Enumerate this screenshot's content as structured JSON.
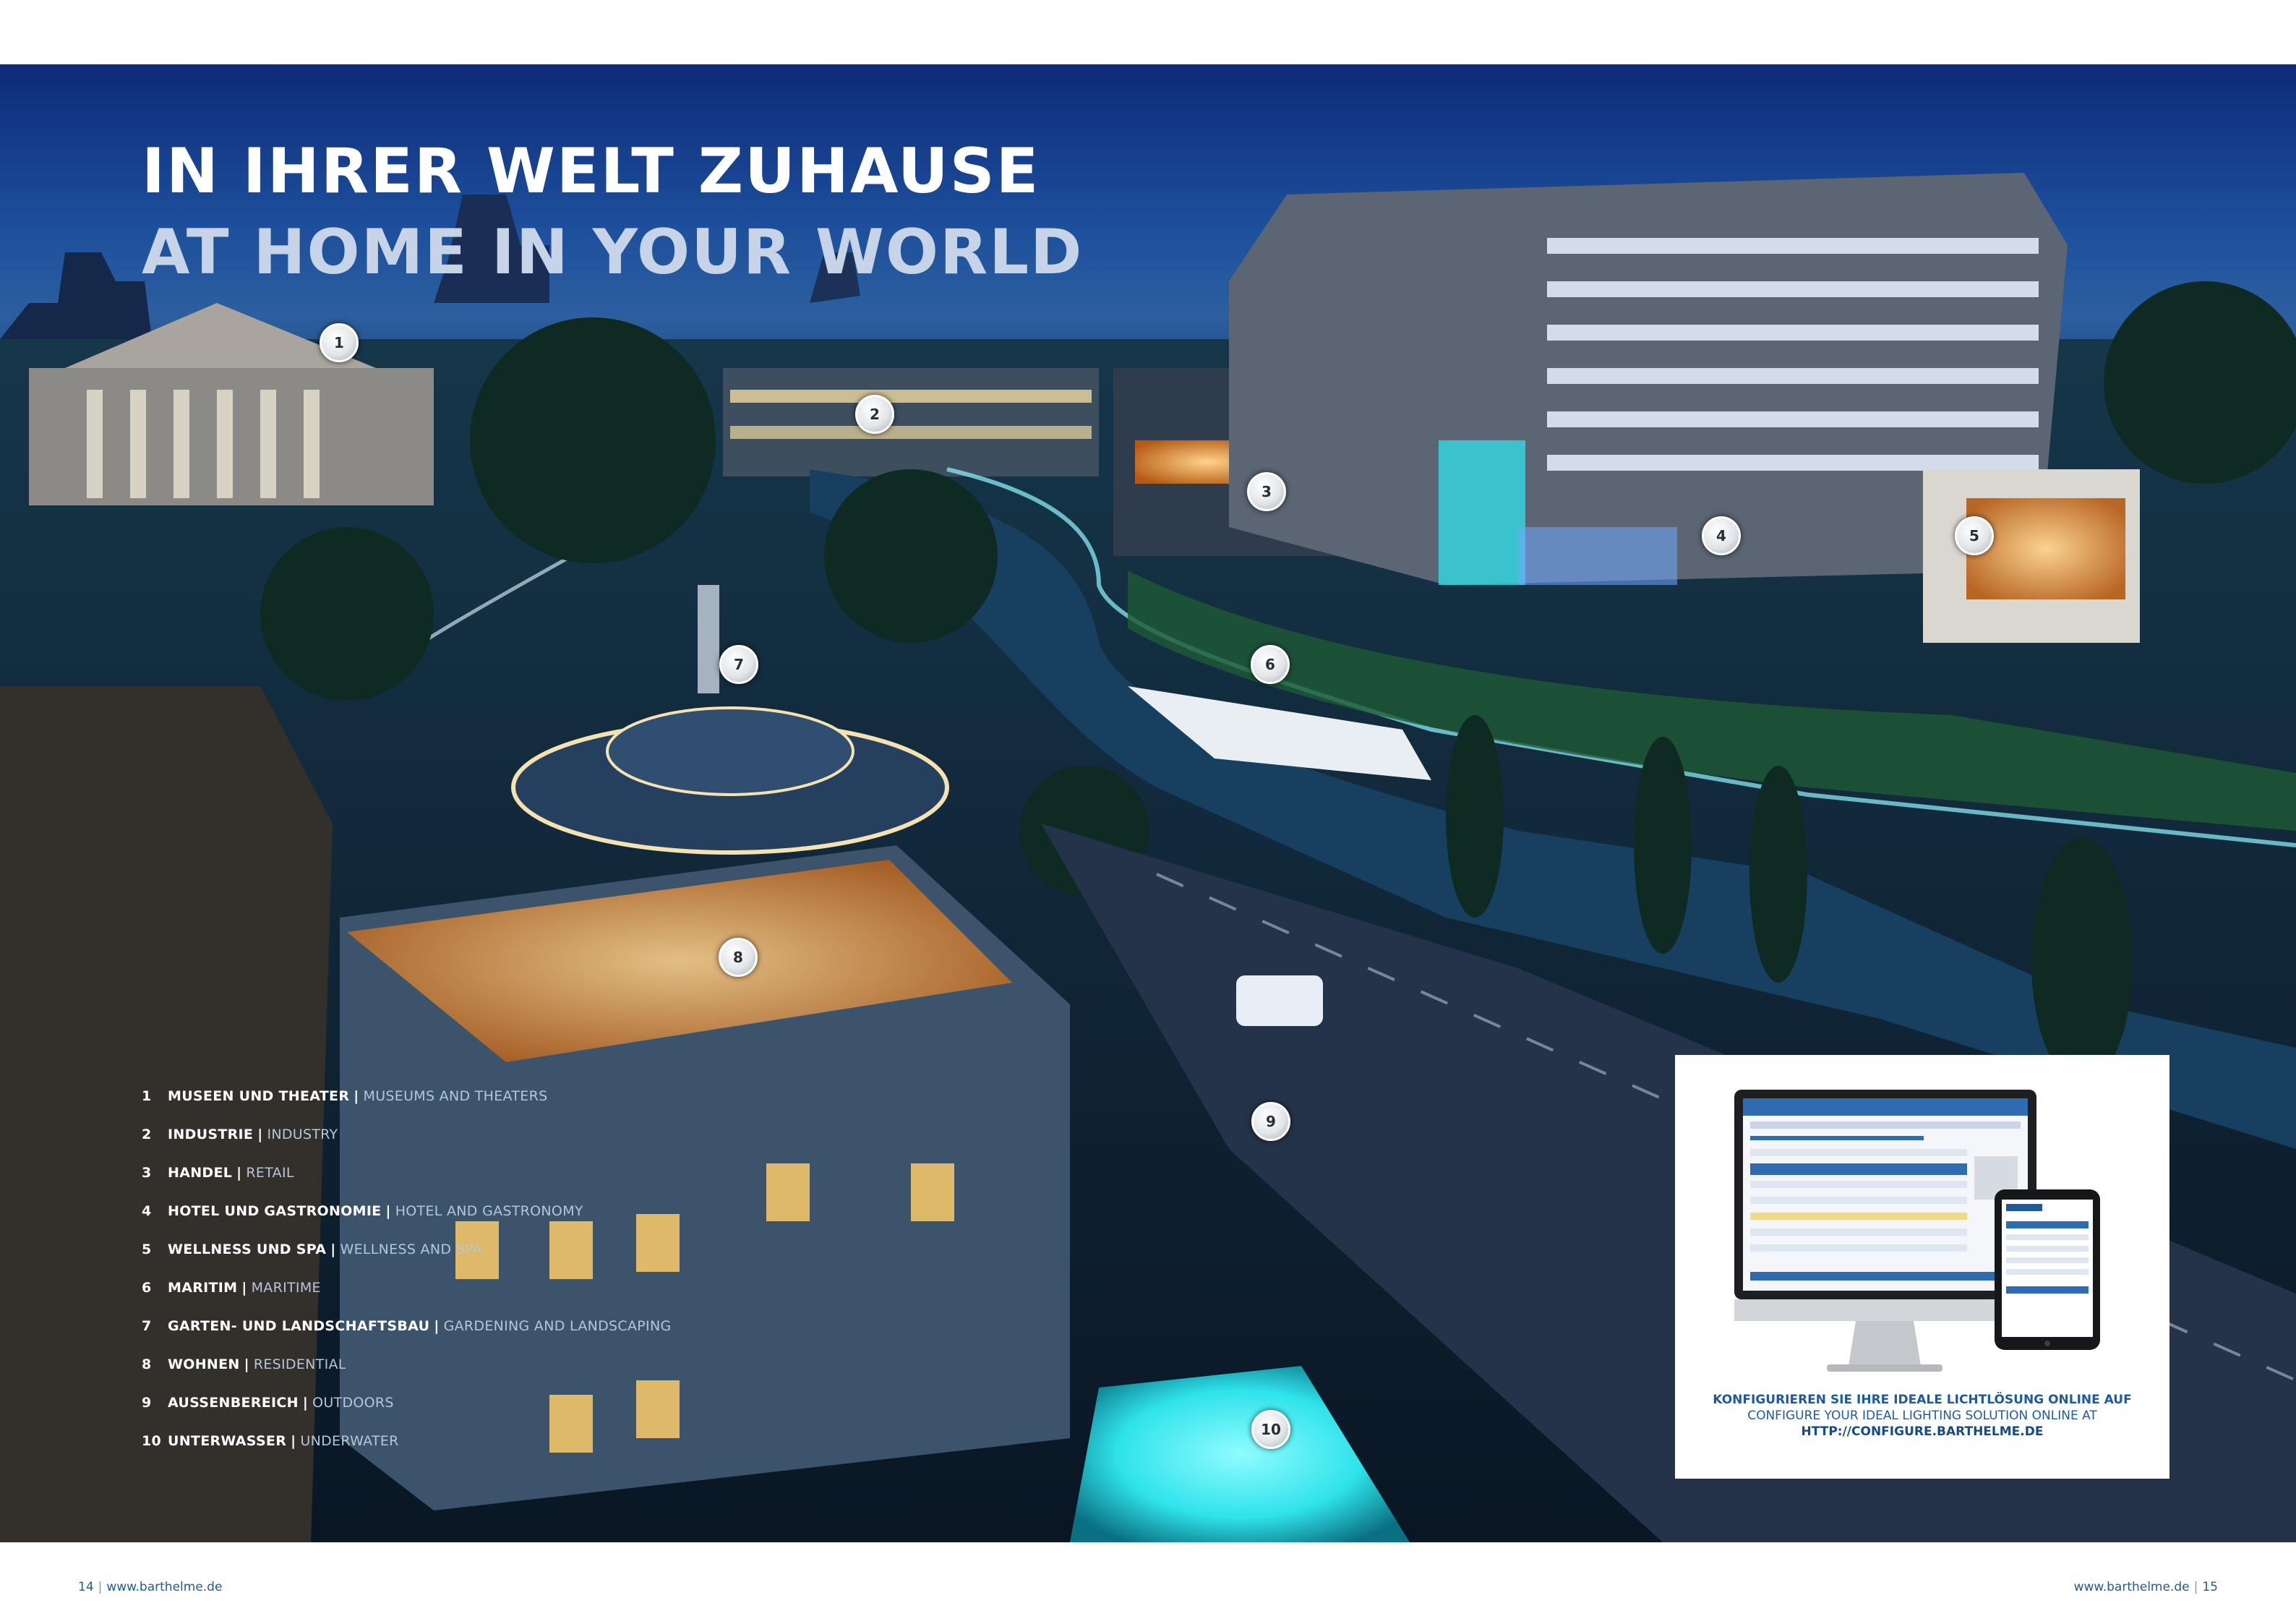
{
  "headline": {
    "line_de": "IN IHRER WELT ZUHAUSE",
    "line_en": "AT HOME IN YOUR WORLD"
  },
  "markers": [
    "1",
    "2",
    "3",
    "4",
    "5",
    "6",
    "7",
    "8",
    "9",
    "10"
  ],
  "legend": [
    {
      "num": "1",
      "de": "MUSEEN UND THEATER",
      "en": "MUSEUMS AND THEATERS"
    },
    {
      "num": "2",
      "de": "INDUSTRIE",
      "en": "INDUSTRY"
    },
    {
      "num": "3",
      "de": "HANDEL",
      "en": "RETAIL"
    },
    {
      "num": "4",
      "de": "HOTEL UND GASTRONOMIE",
      "en": "HOTEL AND GASTRONOMY"
    },
    {
      "num": "5",
      "de": "WELLNESS UND SPA",
      "en": "WELLNESS AND SPA"
    },
    {
      "num": "6",
      "de": "MARITIM",
      "en": "MARITIME"
    },
    {
      "num": "7",
      "de": "GARTEN- UND LANDSCHAFTSBAU",
      "en": "GARDENING AND LANDSCAPING"
    },
    {
      "num": "8",
      "de": "WOHNEN",
      "en": "RESIDENTIAL"
    },
    {
      "num": "9",
      "de": "AUSSENBEREICH",
      "en": "OUTDOORS"
    },
    {
      "num": "10",
      "de": "UNTERWASSER",
      "en": "UNDERWATER"
    }
  ],
  "legend_separator": "|",
  "promo": {
    "line1": "KONFIGURIEREN SIE IHRE IDEALE LICHTLÖSUNG ONLINE AUF",
    "line2": "CONFIGURE YOUR IDEAL LIGHTING SOLUTION ONLINE AT",
    "line3": "HTTP://CONFIGURE.BARTHELME.DE"
  },
  "footer": {
    "left_page": "14",
    "left_url": "www.barthelme.de",
    "right_url": "www.barthelme.de",
    "right_page": "15",
    "separator": "|"
  },
  "colors": {
    "brand_blue": "#1f5a9c",
    "night_sky": "#1d4f9c",
    "teal_glow": "#2fe3ea",
    "warm_light": "#f3a33a"
  }
}
